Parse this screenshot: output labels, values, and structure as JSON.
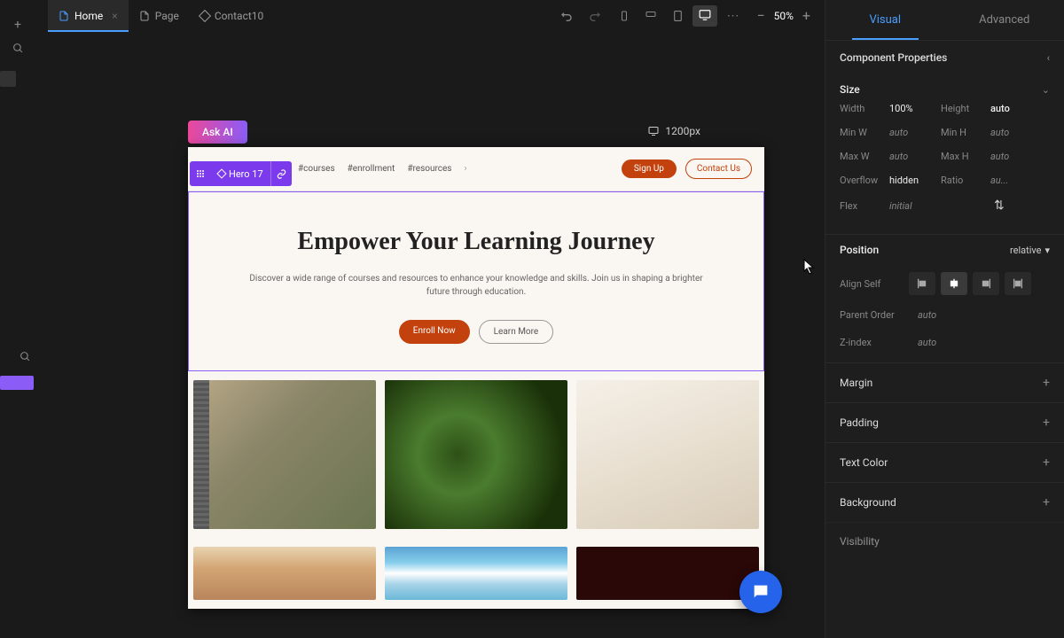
{
  "tabs": [
    {
      "label": "Home",
      "active": true,
      "icon": "doc"
    },
    {
      "label": "Page",
      "active": false,
      "icon": "doc"
    },
    {
      "label": "Contact10",
      "active": false,
      "icon": "diamond"
    }
  ],
  "zoom": "50%",
  "askAi": "Ask AI",
  "viewportLabel": "1200px",
  "selection": {
    "label": "Hero 17"
  },
  "page": {
    "nav": [
      "#courses",
      "#enrollment",
      "#resources"
    ],
    "signup": "Sign Up",
    "contact": "Contact Us",
    "heroTitle": "Empower Your Learning Journey",
    "heroDesc": "Discover a wide range of courses and resources to enhance your knowledge and skills. Join us in shaping a brighter future through education.",
    "enroll": "Enroll Now",
    "learn": "Learn More"
  },
  "panel": {
    "tabVisual": "Visual",
    "tabAdvanced": "Advanced",
    "componentProps": "Component Properties",
    "size": {
      "header": "Size",
      "width": {
        "label": "Width",
        "value": "100%"
      },
      "height": {
        "label": "Height",
        "value": "auto"
      },
      "minw": {
        "label": "Min W",
        "value": "auto"
      },
      "minh": {
        "label": "Min H",
        "value": "auto"
      },
      "maxw": {
        "label": "Max W",
        "value": "auto"
      },
      "maxh": {
        "label": "Max H",
        "value": "auto"
      },
      "overflow": {
        "label": "Overflow",
        "value": "hidden"
      },
      "ratio": {
        "label": "Ratio",
        "value": "au..."
      },
      "flex": {
        "label": "Flex",
        "value": "initial"
      }
    },
    "position": {
      "label": "Position",
      "value": "relative"
    },
    "alignSelf": "Align Self",
    "parentOrder": {
      "label": "Parent Order",
      "value": "auto"
    },
    "zindex": {
      "label": "Z-index",
      "value": "auto"
    },
    "margin": "Margin",
    "padding": "Padding",
    "textColor": "Text Color",
    "background": "Background",
    "visibility": "Visibility"
  }
}
